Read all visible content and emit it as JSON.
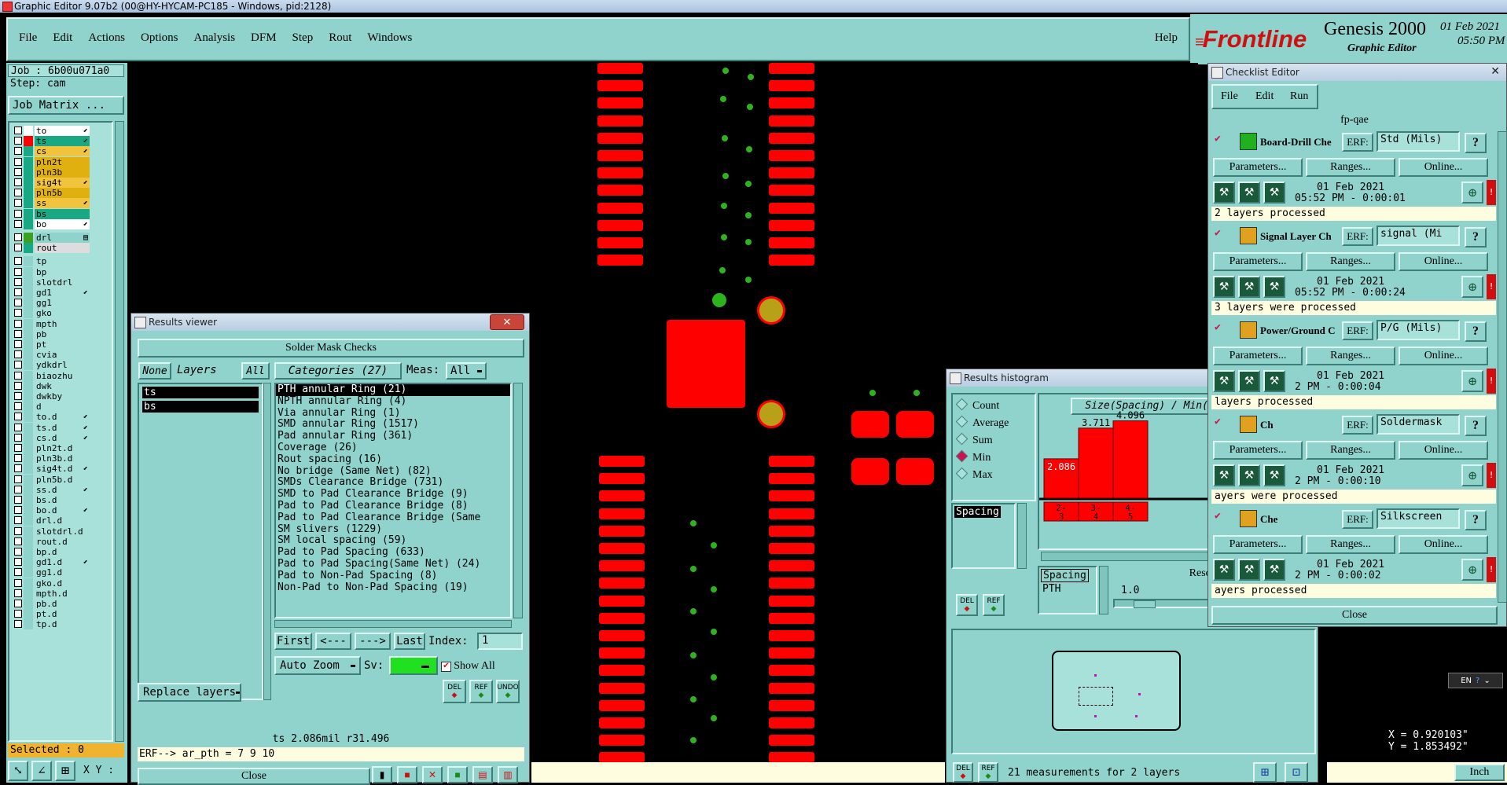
{
  "window_title": "Graphic Editor 9.07b2 (00@HY-HYCAM-PC185 - Windows, pid:2128)",
  "menu": [
    "File",
    "Edit",
    "Actions",
    "Options",
    "Analysis",
    "DFM",
    "Step",
    "Rout",
    "Windows"
  ],
  "help": "Help",
  "brand": {
    "logo": "Frontline",
    "product": "Genesis 2000",
    "subtitle": "Graphic Editor",
    "date": "01 Feb 2021",
    "time": "05:50 PM"
  },
  "job": {
    "job": "Job : 6b00u071a0",
    "step": "Step: cam",
    "matrix_btn": "Job Matrix ..."
  },
  "layers": [
    {
      "name": "to",
      "color": "#ffffff",
      "bg": "#ffffff",
      "arrow": "⬋"
    },
    {
      "name": "ts",
      "color": "#ff0000",
      "bg": "#1aa884",
      "arrow": "⬋"
    },
    {
      "name": "cs",
      "color": "#1aa884",
      "bg": "#f2c33c",
      "arrow": "⬋"
    },
    {
      "name": "pln2t",
      "color": "#1aa884",
      "bg": "#e0b010",
      "arrow": ""
    },
    {
      "name": "pln3b",
      "color": "#1aa884",
      "bg": "#e0b010",
      "arrow": ""
    },
    {
      "name": "sig4t",
      "color": "#1aa884",
      "bg": "#f2c33c",
      "arrow": "⬋"
    },
    {
      "name": "pln5b",
      "color": "#1aa884",
      "bg": "#e0b010",
      "arrow": ""
    },
    {
      "name": "ss",
      "color": "#1aa884",
      "bg": "#f2c33c",
      "arrow": "⬋"
    },
    {
      "name": "bs",
      "color": "#1aa884",
      "bg": "#1aa884",
      "arrow": ""
    },
    {
      "name": "bo",
      "color": "#1aa884",
      "bg": "#ffffff",
      "arrow": "⬋"
    }
  ],
  "drill_layers": [
    {
      "name": "drl",
      "color": "#3e9f22",
      "bg": "#8fd3cc",
      "arrow": "▤"
    },
    {
      "name": "rout",
      "color": "#1aa884",
      "bg": "#dddddd",
      "arrow": ""
    }
  ],
  "misc_layers": [
    "tp",
    "bp",
    "slotdrl",
    "gd1",
    "gg1",
    "gko",
    "mpth",
    "pb",
    "pt",
    "cvia",
    "ydkdrl",
    "biaozhu",
    "dwk",
    "dwkby",
    "d",
    "to.d",
    "ts.d",
    "cs.d",
    "pln2t.d",
    "pln3b.d",
    "sig4t.d",
    "pln5b.d",
    "ss.d",
    "bs.d",
    "bo.d",
    "drl.d",
    "slotdrl.d",
    "rout.d",
    "bp.d",
    "gd1.d",
    "gg1.d",
    "gko.d",
    "mpth.d",
    "pb.d",
    "pt.d",
    "tp.d"
  ],
  "misc_arrows": [
    3,
    15,
    16,
    17,
    20,
    22,
    24,
    29
  ],
  "selected": "Selected : 0",
  "xy_label": "X Y :",
  "results_viewer": {
    "title": "Results viewer",
    "header": "Solder Mask Checks",
    "none_btn": "None",
    "layers_label": "Layers",
    "all_btn": "All",
    "layer_items": [
      "ts",
      "bs"
    ],
    "categories_label": "Categories (27)",
    "meas_label": "Meas:",
    "meas_value": "All",
    "categories": [
      "PTH annular Ring (21)",
      "NPTH annular Ring (4)",
      "Via annular Ring (1)",
      "SMD annular Ring (1517)",
      "Pad annular Ring (361)",
      "Coverage (26)",
      "Rout spacing (16)",
      "No bridge (Same Net) (82)",
      "SMDs Clearance Bridge (731)",
      "SMD to Pad Clearance Bridge (9)",
      "Pad to Pad Clearance Bridge (8)",
      "Pad to Pad Clearance Bridge (Same",
      "SM slivers (1229)",
      "SM local spacing (59)",
      "Pad to Pad Spacing (633)",
      "Pad to Pad Spacing(Same Net) (24)",
      "Pad to Non-Pad Spacing (8)",
      "Non-Pad to Non-Pad Spacing (19)"
    ],
    "first": "First",
    "prev": "<---",
    "next": "--->",
    "last": "Last",
    "index_label": "Index:",
    "index_value": "1",
    "auto_zoom": "Auto Zoom",
    "sv_label": "Sv:",
    "show_all": "Show All",
    "replace_layers": "Replace layers",
    "del": "DEL",
    "ref": "REF",
    "undo": "UNDO",
    "status": "ts 2.086mil  r31.496",
    "erf": "ERF--> ar_pth = 7 9 10",
    "close": "Close"
  },
  "histogram": {
    "title": "Results histogram",
    "options": [
      "Count",
      "Average",
      "Sum",
      "Min",
      "Max"
    ],
    "selected_option": "Min",
    "list_item": "Spacing",
    "chart_title": "Size(Spacing) / Min(Spacing)",
    "chart_data": {
      "type": "bar",
      "categories": [
        "2-3",
        "3-4",
        "4-5"
      ],
      "values": [
        2.086,
        3.711,
        4.096
      ],
      "labels": [
        "2.086",
        "3.711",
        "4.096"
      ],
      "ylim": [
        0,
        4.5
      ]
    },
    "cat_labels": [
      [
        "2-",
        "3"
      ],
      [
        "3-",
        "4"
      ],
      [
        "4-",
        "5"
      ]
    ],
    "spacing_box": [
      "Spacing",
      "PTH"
    ],
    "resolution_label": "Resolution",
    "resolution_value": "1.0",
    "del": "DEL",
    "ref": "REF",
    "status": "21 measurements for 2 layers"
  },
  "checklist": {
    "title": "Checklist Editor",
    "menu": [
      "File",
      "Edit",
      "Run"
    ],
    "name": "fp-qae",
    "items": [
      {
        "name": "Board-Drill Che",
        "erf": "ERF:",
        "erf_value": "Std (Mils)",
        "date": "01 Feb 2021",
        "time": "05:52 PM - 0:00:01",
        "status": "2 layers processed"
      },
      {
        "name": "Signal Layer Ch",
        "erf": "ERF:",
        "erf_value": "signal (Mi",
        "date": "01 Feb 2021",
        "time": "05:52 PM - 0:00:24",
        "status": "3 layers were processed"
      },
      {
        "name": "Power/Ground C",
        "erf": "ERF:",
        "erf_value": "P/G (Mils)",
        "date": "01 Feb 2021",
        "time": "2 PM - 0:00:04",
        "status": "layers processed"
      },
      {
        "name": "Ch",
        "erf": "ERF:",
        "erf_value": "Soldermask",
        "date": "01 Feb 2021",
        "time": "2 PM - 0:00:10",
        "status": "ayers were processed"
      },
      {
        "name": "Che",
        "erf": "ERF:",
        "erf_value": "Silkscreen",
        "date": "01 Feb 2021",
        "time": "2 PM - 0:00:02",
        "status": "ayers processed"
      }
    ],
    "parameters": "Parameters...",
    "ranges": "Ranges...",
    "online": "Online...",
    "close": "Close"
  },
  "coords": {
    "x": "X = 0.920103\"",
    "y": "Y = 1.853492\""
  },
  "units": "Inch",
  "lang": "EN"
}
